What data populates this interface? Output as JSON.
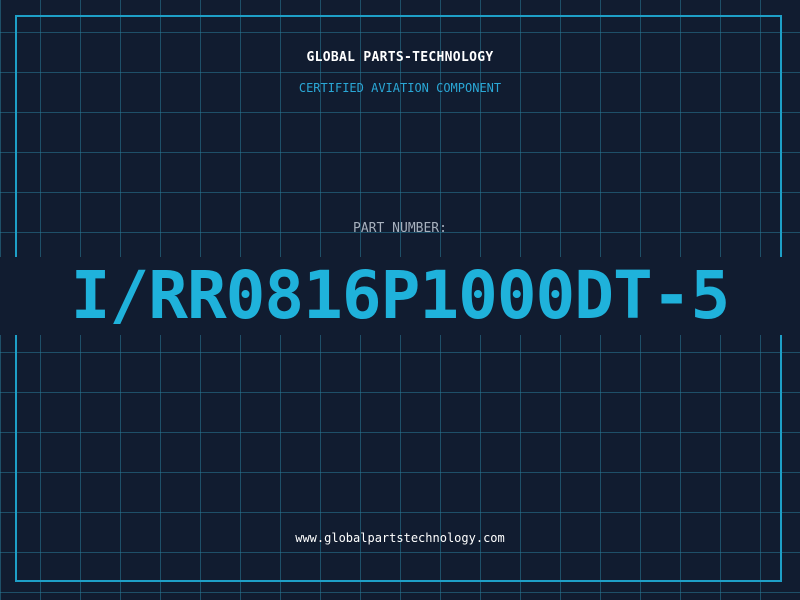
{
  "header": {
    "company_name": "GLOBAL PARTS-TECHNOLOGY",
    "tagline": "CERTIFIED AVIATION COMPONENT"
  },
  "part": {
    "label": "PART NUMBER:",
    "number": "I/RR0816P1000DT-5"
  },
  "footer": {
    "website": "www.globalpartstechnology.com"
  },
  "colors": {
    "background": "#111c30",
    "grid": "#287896",
    "accent": "#1fb2db",
    "border": "#1e9fc7",
    "label": "#a7b0bd"
  }
}
